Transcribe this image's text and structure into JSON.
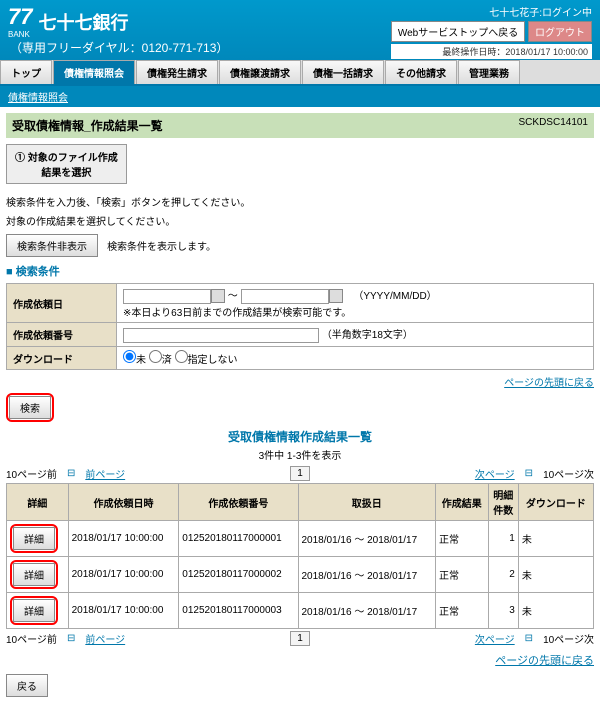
{
  "header": {
    "bank_num": "77",
    "bank_sub": "BANK",
    "bank_name": "七十七銀行",
    "dial": "（専用フリーダイヤル：0120-771-713）",
    "login_status": "七十七花子:ログイン中",
    "btn_back": "Webサービストップへ戻る",
    "btn_logout": "ログアウト",
    "last_op": "最終操作日時：2018/01/17 10:00:00"
  },
  "tabs": [
    "トップ",
    "債権情報照会",
    "債権発生請求",
    "債権譲渡請求",
    "債権一括請求",
    "その他請求",
    "管理業務"
  ],
  "subbar": "債権情報照会",
  "section": {
    "title": "受取債権情報_作成結果一覧",
    "screen_id": "SCKDSC14101"
  },
  "step": "① 対象のファイル作成\n結果を選択",
  "instr1": "検索条件を入力後、「検索」ボタンを押してください。",
  "instr2": "対象の作成結果を選択してください。",
  "btn_hide": "検索条件非表示",
  "hide_note": "検索条件を表示します。",
  "cond_hdr": "検索条件",
  "form": {
    "f1": {
      "label": "作成依頼日",
      "note": "（YYYY/MM/DD）\n※本日より63日前までの作成結果が検索可能です。",
      "sep": "～"
    },
    "f2": {
      "label": "作成依頼番号",
      "note": "（半角数字18文字）"
    },
    "f3": {
      "label": "ダウンロード",
      "opts": [
        "未",
        "済",
        "指定しない"
      ]
    }
  },
  "btn_search": "検索",
  "back_top": "ページの先頭に戻る",
  "list_title": "受取債権情報作成結果一覧",
  "list_sub": "3件中 1-3件を表示",
  "pager": {
    "p10p": "10ページ前",
    "pp": "前ページ",
    "np": "次ページ",
    "p10n": "10ページ次",
    "pg": "1"
  },
  "cols": [
    "詳細",
    "作成依頼日時",
    "作成依頼番号",
    "取扱日",
    "作成結果",
    "明細\n件数",
    "ダウンロード"
  ],
  "rows": [
    {
      "btn": "詳細",
      "dt": "2018/01/17 10:00:00",
      "no": "012520180117000001",
      "range": "2018/01/16 ～ 2018/01/17",
      "res": "正常",
      "cnt": "1",
      "dl": "未"
    },
    {
      "btn": "詳細",
      "dt": "2018/01/17 10:00:00",
      "no": "012520180117000002",
      "range": "2018/01/16 ～ 2018/01/17",
      "res": "正常",
      "cnt": "2",
      "dl": "未"
    },
    {
      "btn": "詳細",
      "dt": "2018/01/17 10:00:00",
      "no": "012520180117000003",
      "range": "2018/01/16 ～ 2018/01/17",
      "res": "正常",
      "cnt": "3",
      "dl": "未"
    }
  ],
  "btn_back": "戻る"
}
